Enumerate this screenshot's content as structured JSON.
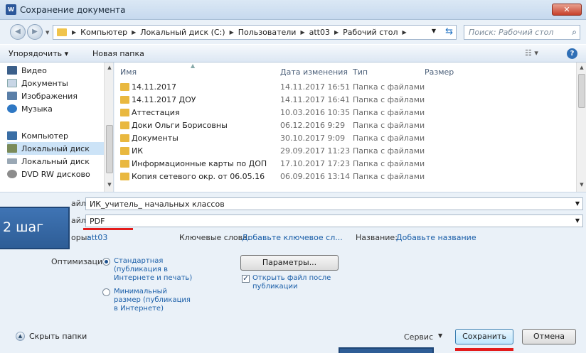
{
  "window": {
    "title": "Сохранение документа",
    "app_icon_text": "W",
    "close_label": "✕"
  },
  "address": {
    "crumbs": [
      "Компьютер",
      "Локальный диск (C:)",
      "Пользователи",
      "att03",
      "Рабочий стол"
    ],
    "search_placeholder": "Поиск: Рабочий стол"
  },
  "toolbar": {
    "organize_label": "Упорядочить ▾",
    "new_folder_label": "Новая папка",
    "views_label": "☷ ▾",
    "help_label": "?"
  },
  "nav": {
    "items": [
      {
        "label": "Видео",
        "icon": "video-library-icon",
        "color": "#3b5f8a"
      },
      {
        "label": "Документы",
        "icon": "documents-library-icon",
        "color": "#c8d6e6"
      },
      {
        "label": "Изображения",
        "icon": "pictures-library-icon",
        "color": "#5a7fa8"
      },
      {
        "label": "Музыка",
        "icon": "music-library-icon",
        "color": "#2f78c4"
      },
      {
        "label": "Компьютер",
        "icon": "computer-icon",
        "color": "#3a6ea5"
      },
      {
        "label": "Локальный диск",
        "icon": "local-disk-icon",
        "color": "#7a8b5a"
      },
      {
        "label": "Локальный диск",
        "icon": "local-disk-icon",
        "color": "#9aa8b5"
      },
      {
        "label": "DVD RW дисково",
        "icon": "dvd-drive-icon",
        "color": "#8c8c8c"
      }
    ]
  },
  "list": {
    "columns": [
      "Имя",
      "Дата изменения",
      "Тип",
      "Размер"
    ],
    "rows": [
      {
        "name": "14.11.2017",
        "date": "14.11.2017 16:51",
        "type": "Папка с файлами"
      },
      {
        "name": "14.11.2017 ДОУ",
        "date": "14.11.2017 16:41",
        "type": "Папка с файлами"
      },
      {
        "name": "Аттестация",
        "date": "10.03.2016 10:35",
        "type": "Папка с файлами"
      },
      {
        "name": "Доки Ольги Борисовны",
        "date": "06.12.2016 9:29",
        "type": "Папка с файлами"
      },
      {
        "name": "Документы",
        "date": "30.10.2017 9:09",
        "type": "Папка с файлами"
      },
      {
        "name": "ИК",
        "date": "29.09.2017 11:23",
        "type": "Папка с файлами"
      },
      {
        "name": "Информационные карты по ДОП",
        "date": "17.10.2017 17:23",
        "type": "Папка с файлами"
      },
      {
        "name": "Копия сетевого окр. от 06.05.16",
        "date": "06.09.2016 13:14",
        "type": "Папка с файлами"
      }
    ]
  },
  "form": {
    "filename_label": "айла:",
    "filename_value": "ИК_учитель_ начальных классов",
    "filetype_label": "айла:",
    "filetype_value": "PDF",
    "authors_label": "оры:",
    "authors_value": "att03",
    "keywords_label": "Ключевые слова:",
    "keywords_value": "Добавьте ключевое сл...",
    "title_label": "Название:",
    "title_value": "Добавьте название",
    "step_text": "2 шаг",
    "optimize_label": "Оптимизация:",
    "opt_standard": "Стандартная\n(публикация в\nИнтернете и печать)",
    "opt_minimal": "Минимальный\nразмер (публикация\nв Интернете)",
    "params_label": "Параметры...",
    "open_after_label": "Открыть файл после\nпубликации",
    "hide_folders_label": "Скрыть папки",
    "service_label": "Сервис",
    "save_label": "Сохранить",
    "cancel_label": "Отмена"
  }
}
